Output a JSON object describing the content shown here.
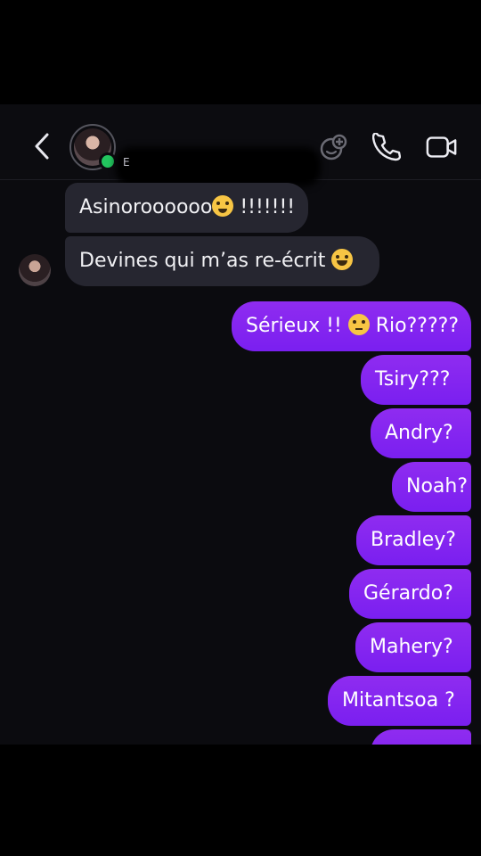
{
  "header": {
    "contact_name": "E",
    "icons": [
      "back-chevron-icon",
      "sticker-icon",
      "phone-icon",
      "video-camera-icon"
    ]
  },
  "messages": [
    {
      "direction": "incoming",
      "text": "Asinoroooooo",
      "emoji": "crying-face",
      "text_after": " !!!!!!!"
    },
    {
      "direction": "incoming",
      "text": "Devines qui m’as re-écrit ",
      "emoji": "rolling-laughing-face"
    },
    {
      "direction": "outgoing",
      "text": "Sérieux !! ",
      "emoji": "eye-roll-face",
      "text_after": " Rio?????"
    },
    {
      "direction": "outgoing",
      "text": "Tsiry???"
    },
    {
      "direction": "outgoing",
      "text": "Andry?"
    },
    {
      "direction": "outgoing",
      "text": "Noah?"
    },
    {
      "direction": "outgoing",
      "text": "Bradley?"
    },
    {
      "direction": "outgoing",
      "text": "Gérardo?"
    },
    {
      "direction": "outgoing",
      "text": "Mahery?"
    },
    {
      "direction": "outgoing",
      "text": "Mitantsoa ?"
    }
  ],
  "colors": {
    "outgoing_bubble": "#8a28f0",
    "incoming_bubble": "#262630",
    "online": "#22c55e",
    "background": "#0b0b0f"
  }
}
